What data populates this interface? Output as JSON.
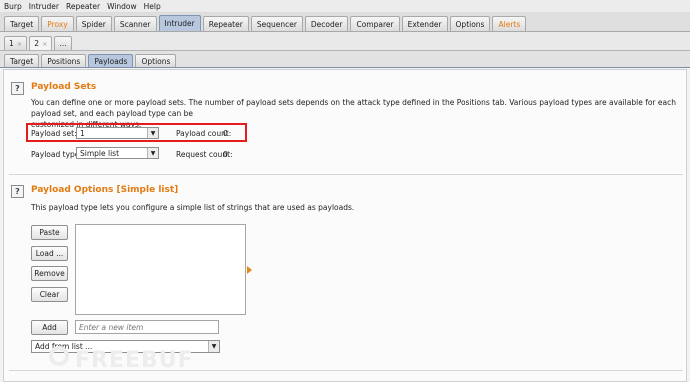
{
  "menu": [
    "Burp",
    "Intruder",
    "Repeater",
    "Window",
    "Help"
  ],
  "main_tabs": [
    {
      "label": "Target"
    },
    {
      "label": "Proxy"
    },
    {
      "label": "Spider"
    },
    {
      "label": "Scanner"
    },
    {
      "label": "Intruder"
    },
    {
      "label": "Repeater"
    },
    {
      "label": "Sequencer"
    },
    {
      "label": "Decoder"
    },
    {
      "label": "Comparer"
    },
    {
      "label": "Extender"
    },
    {
      "label": "Options"
    },
    {
      "label": "Alerts"
    }
  ],
  "accent_orange": "#e37b12",
  "instance_tabs": [
    {
      "label": "1",
      "close": "×"
    },
    {
      "label": "2",
      "close": "×"
    },
    {
      "label": "..."
    }
  ],
  "sub_tabs": [
    {
      "label": "Target"
    },
    {
      "label": "Positions"
    },
    {
      "label": "Payloads"
    },
    {
      "label": "Options"
    }
  ],
  "payload_sets": {
    "help": "?",
    "title": "Payload Sets",
    "description_line1": "You can define one or more payload sets. The number of payload sets depends on the attack type defined in the Positions tab. Various payload types are available for each payload set, and each payload type can be",
    "description_line2": "customized in different ways.",
    "set_label": "Payload set:",
    "set_value": "1",
    "count_label": "Payload count:",
    "count_value": "0",
    "type_label": "Payload type:",
    "type_value": "Simple list",
    "request_label": "Request count:",
    "request_value": "0"
  },
  "payload_options": {
    "help": "?",
    "title": "Payload Options [Simple list]",
    "description": "This payload type lets you configure a simple list of strings that are used as payloads.",
    "buttons": {
      "paste": "Paste",
      "load": "Load ...",
      "remove": "Remove",
      "clear": "Clear",
      "add": "Add"
    },
    "new_item_placeholder": "Enter a new item",
    "add_from_list": "Add from list ..."
  },
  "watermark": "FREEBUF"
}
